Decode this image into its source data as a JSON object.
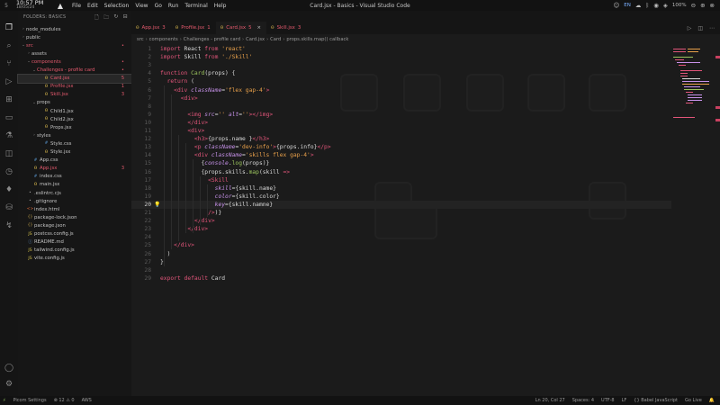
{
  "system": {
    "workspace": "5",
    "time": "10:57 PM",
    "date": "18/05/24",
    "menu": [
      "File",
      "Edit",
      "Selection",
      "View",
      "Go",
      "Run",
      "Terminal",
      "Help"
    ],
    "window_title": "Card.jsx - Basics - Visual Studio Code",
    "lang": "EN",
    "battery": "100%"
  },
  "sidebar": {
    "header": "FOLDERS: BASICS",
    "items": [
      {
        "label": "node_modules",
        "indent": 0,
        "chev": "›",
        "icon": "folder",
        "state": "normal"
      },
      {
        "label": "public",
        "indent": 0,
        "chev": "›",
        "icon": "folder",
        "state": "normal"
      },
      {
        "label": "src",
        "indent": 0,
        "chev": "⌄",
        "icon": "folder",
        "state": "error",
        "badge": "•"
      },
      {
        "label": "assets",
        "indent": 1,
        "chev": "›",
        "icon": "folder",
        "state": "normal"
      },
      {
        "label": "components",
        "indent": 1,
        "chev": "⌄",
        "icon": "folder",
        "state": "error",
        "badge": "•"
      },
      {
        "label": "Challenges - profile card",
        "indent": 2,
        "chev": "⌄",
        "icon": "folder",
        "state": "error",
        "badge": "•"
      },
      {
        "label": "Card.jsx",
        "indent": 3,
        "chev": "",
        "icon": "react",
        "state": "selected-error",
        "badge": "5"
      },
      {
        "label": "Profile.jsx",
        "indent": 3,
        "chev": "",
        "icon": "react",
        "state": "error",
        "badge": "1"
      },
      {
        "label": "Skill.jsx",
        "indent": 3,
        "chev": "",
        "icon": "react",
        "state": "error",
        "badge": "3"
      },
      {
        "label": "props",
        "indent": 2,
        "chev": "⌄",
        "icon": "folder",
        "state": "normal"
      },
      {
        "label": "Child1.jsx",
        "indent": 3,
        "chev": "",
        "icon": "react",
        "state": "normal"
      },
      {
        "label": "Child2.jsx",
        "indent": 3,
        "chev": "",
        "icon": "react",
        "state": "normal"
      },
      {
        "label": "Props.jsx",
        "indent": 3,
        "chev": "",
        "icon": "react",
        "state": "normal"
      },
      {
        "label": "styles",
        "indent": 2,
        "chev": "›",
        "icon": "folder",
        "state": "normal"
      },
      {
        "label": "Style.css",
        "indent": 3,
        "chev": "",
        "icon": "css",
        "state": "normal"
      },
      {
        "label": "Style.jsx",
        "indent": 3,
        "chev": "",
        "icon": "react",
        "state": "normal"
      },
      {
        "label": "App.css",
        "indent": 1,
        "chev": "",
        "icon": "css",
        "state": "normal"
      },
      {
        "label": "App.jsx",
        "indent": 1,
        "chev": "",
        "icon": "react",
        "state": "error",
        "badge": "3"
      },
      {
        "label": "index.css",
        "indent": 1,
        "chev": "",
        "icon": "css",
        "state": "normal"
      },
      {
        "label": "main.jsx",
        "indent": 1,
        "chev": "",
        "icon": "react",
        "state": "normal"
      },
      {
        "label": ".eslintrc.cjs",
        "indent": 0,
        "chev": "",
        "icon": "misc",
        "state": "normal"
      },
      {
        "label": ".gitignore",
        "indent": 0,
        "chev": "",
        "icon": "misc",
        "state": "normal"
      },
      {
        "label": "index.html",
        "indent": 0,
        "chev": "",
        "icon": "html",
        "state": "normal"
      },
      {
        "label": "package-lock.json",
        "indent": 0,
        "chev": "",
        "icon": "json",
        "state": "normal"
      },
      {
        "label": "package.json",
        "indent": 0,
        "chev": "",
        "icon": "json",
        "state": "normal"
      },
      {
        "label": "postcss.config.js",
        "indent": 0,
        "chev": "",
        "icon": "js",
        "state": "normal"
      },
      {
        "label": "README.md",
        "indent": 0,
        "chev": "",
        "icon": "md",
        "state": "normal"
      },
      {
        "label": "tailwind.config.js",
        "indent": 0,
        "chev": "",
        "icon": "js",
        "state": "normal"
      },
      {
        "label": "vite.config.js",
        "indent": 0,
        "chev": "",
        "icon": "js",
        "state": "normal"
      }
    ]
  },
  "tabs": [
    {
      "icon": "react",
      "label": "App.jsx",
      "badge": "3",
      "active": false
    },
    {
      "icon": "react",
      "label": "Profile.jsx",
      "badge": "1",
      "active": false
    },
    {
      "icon": "react",
      "label": "Card.jsx",
      "badge": "5",
      "active": true
    },
    {
      "icon": "react",
      "label": "Skill.jsx",
      "badge": "3",
      "active": false
    }
  ],
  "breadcrumb": [
    "src",
    "components",
    "Challenges - profile card",
    "Card.jsx",
    "Card",
    "props.skills.map() callback"
  ],
  "editor": {
    "current_line": 20,
    "lines": [
      [
        [
          "kw",
          "import"
        ],
        [
          "pl",
          " React "
        ],
        [
          "kw",
          "from"
        ],
        [
          "str",
          " 'react'"
        ]
      ],
      [
        [
          "kw",
          "import"
        ],
        [
          "pl",
          " Skill "
        ],
        [
          "kw",
          "from"
        ],
        [
          "str",
          " './Skill'"
        ]
      ],
      [],
      [
        [
          "kw",
          "function"
        ],
        [
          "fn",
          " Card"
        ],
        [
          "pl",
          "(props) {"
        ]
      ],
      [
        [
          "pl",
          "  "
        ],
        [
          "kw",
          "return"
        ],
        [
          "pl",
          " ("
        ]
      ],
      [
        [
          "pl",
          "    "
        ],
        [
          "tag",
          "<div"
        ],
        [
          "attr",
          " className"
        ],
        [
          "pl",
          "="
        ],
        [
          "str",
          "'flex gap-4'"
        ],
        [
          "tag",
          ">"
        ]
      ],
      [
        [
          "pl",
          "      "
        ],
        [
          "tag",
          "<div>"
        ]
      ],
      [],
      [
        [
          "pl",
          "        "
        ],
        [
          "tag",
          "<img"
        ],
        [
          "attr",
          " src"
        ],
        [
          "pl",
          "="
        ],
        [
          "str",
          "''"
        ],
        [
          "attr",
          " alt"
        ],
        [
          "pl",
          "="
        ],
        [
          "str",
          "''"
        ],
        [
          "tag",
          "></img>"
        ]
      ],
      [
        [
          "pl",
          "        "
        ],
        [
          "tag",
          "</div>"
        ]
      ],
      [
        [
          "pl",
          "        "
        ],
        [
          "tag",
          "<div>"
        ]
      ],
      [
        [
          "pl",
          "          "
        ],
        [
          "tag",
          "<h3>"
        ],
        [
          "pl",
          "{props.name }"
        ],
        [
          "tag",
          "</h3>"
        ]
      ],
      [
        [
          "pl",
          "          "
        ],
        [
          "tag",
          "<p"
        ],
        [
          "attr",
          " className"
        ],
        [
          "pl",
          "="
        ],
        [
          "str",
          "'dev-info'"
        ],
        [
          "tag",
          ">"
        ],
        [
          "pl",
          "{props.info}"
        ],
        [
          "tag",
          "</p>"
        ]
      ],
      [
        [
          "pl",
          "          "
        ],
        [
          "tag",
          "<div"
        ],
        [
          "attr",
          " className"
        ],
        [
          "pl",
          "="
        ],
        [
          "str",
          "'skills flex gap-4'"
        ],
        [
          "tag",
          ">"
        ]
      ],
      [
        [
          "pl",
          "            {"
        ],
        [
          "attr",
          "console"
        ],
        [
          "pl",
          "."
        ],
        [
          "fn",
          "log"
        ],
        [
          "pl",
          "(props)}"
        ]
      ],
      [
        [
          "pl",
          "            {props.skills."
        ],
        [
          "fn",
          "map"
        ],
        [
          "pl",
          "(skill "
        ],
        [
          "kw",
          "=>"
        ]
      ],
      [
        [
          "pl",
          "              "
        ],
        [
          "tag",
          "<Skill"
        ]
      ],
      [
        [
          "pl",
          "                "
        ],
        [
          "attr",
          "skill"
        ],
        [
          "pl",
          "={skill.name}"
        ]
      ],
      [
        [
          "pl",
          "                "
        ],
        [
          "attr",
          "color"
        ],
        [
          "pl",
          "={skill.color}"
        ]
      ],
      [
        [
          "pl",
          "                "
        ],
        [
          "attr",
          "key"
        ],
        [
          "pl",
          "={skill.namne}"
        ]
      ],
      [
        [
          "pl",
          "              "
        ],
        [
          "tag",
          "/>"
        ],
        [
          "pl",
          ")}"
        ]
      ],
      [
        [
          "pl",
          "          "
        ],
        [
          "tag",
          "</div>"
        ]
      ],
      [
        [
          "pl",
          "        "
        ],
        [
          "tag",
          "</div>"
        ]
      ],
      [],
      [
        [
          "pl",
          "    "
        ],
        [
          "tag",
          "</div>"
        ]
      ],
      [
        [
          "pl",
          "  )"
        ]
      ],
      [
        [
          "pl",
          "}"
        ]
      ],
      [],
      [
        [
          "kw",
          "export"
        ],
        [
          "kw",
          " default"
        ],
        [
          "pl",
          " Card"
        ]
      ]
    ]
  },
  "status": {
    "left": [
      "Picom Settings",
      "⊗ 12 ⚠ 0",
      "AWS"
    ],
    "right": [
      "Ln 20, Col 27",
      "Spaces: 4",
      "UTF-8",
      "LF",
      "{} Babel JavaScript",
      "Go Live"
    ]
  }
}
